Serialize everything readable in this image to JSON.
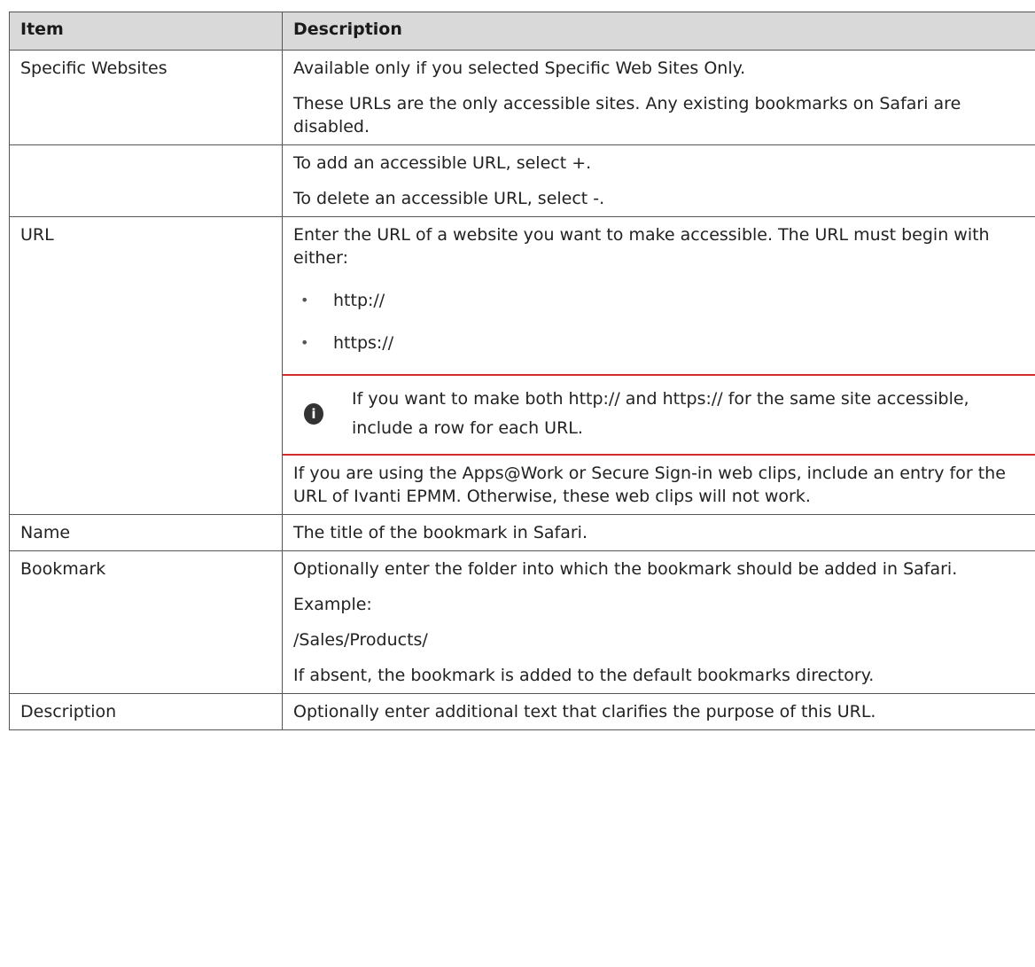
{
  "table": {
    "headers": [
      "Item",
      "Description"
    ],
    "rows": [
      {
        "item": "Specific Websites",
        "paragraphs": [
          "Available only if you selected Specific Web Sites Only.",
          "These URLs are the only accessible sites. Any existing bookmarks on Safari are disabled."
        ]
      },
      {
        "item": "",
        "paragraphs": [
          "To add an accessible URL, select +.",
          "To delete an accessible URL, select -."
        ]
      },
      {
        "item": "URL",
        "intro": "Enter the URL of a website you want to make accessible. The URL must begin with either:",
        "bullets": [
          "http://",
          "https://"
        ],
        "bullet_char": "•",
        "note": {
          "icon": "info-icon",
          "icon_glyph": "i",
          "text": "If you want to make both http:// and https:// for the same site accessible, include a row for each URL."
        },
        "outro": "If you are using the Apps@Work or Secure Sign-in web clips, include an entry for the URL of Ivanti EPMM. Otherwise, these web clips will not work."
      },
      {
        "item": "Name",
        "paragraphs": [
          "The title of the bookmark in Safari."
        ]
      },
      {
        "item": "Bookmark",
        "paragraphs": [
          "Optionally enter the folder into which the bookmark should be added in Safari.",
          "Example:",
          "/Sales/Products/",
          "If absent, the bookmark is added to the default bookmarks directory."
        ]
      },
      {
        "item": "Description",
        "paragraphs": [
          "Optionally enter additional text that clarifies the purpose of this URL."
        ]
      }
    ]
  },
  "colors": {
    "header_bg": "#d9d9d9",
    "border": "#555555",
    "note_rule": "#d22b2b"
  }
}
